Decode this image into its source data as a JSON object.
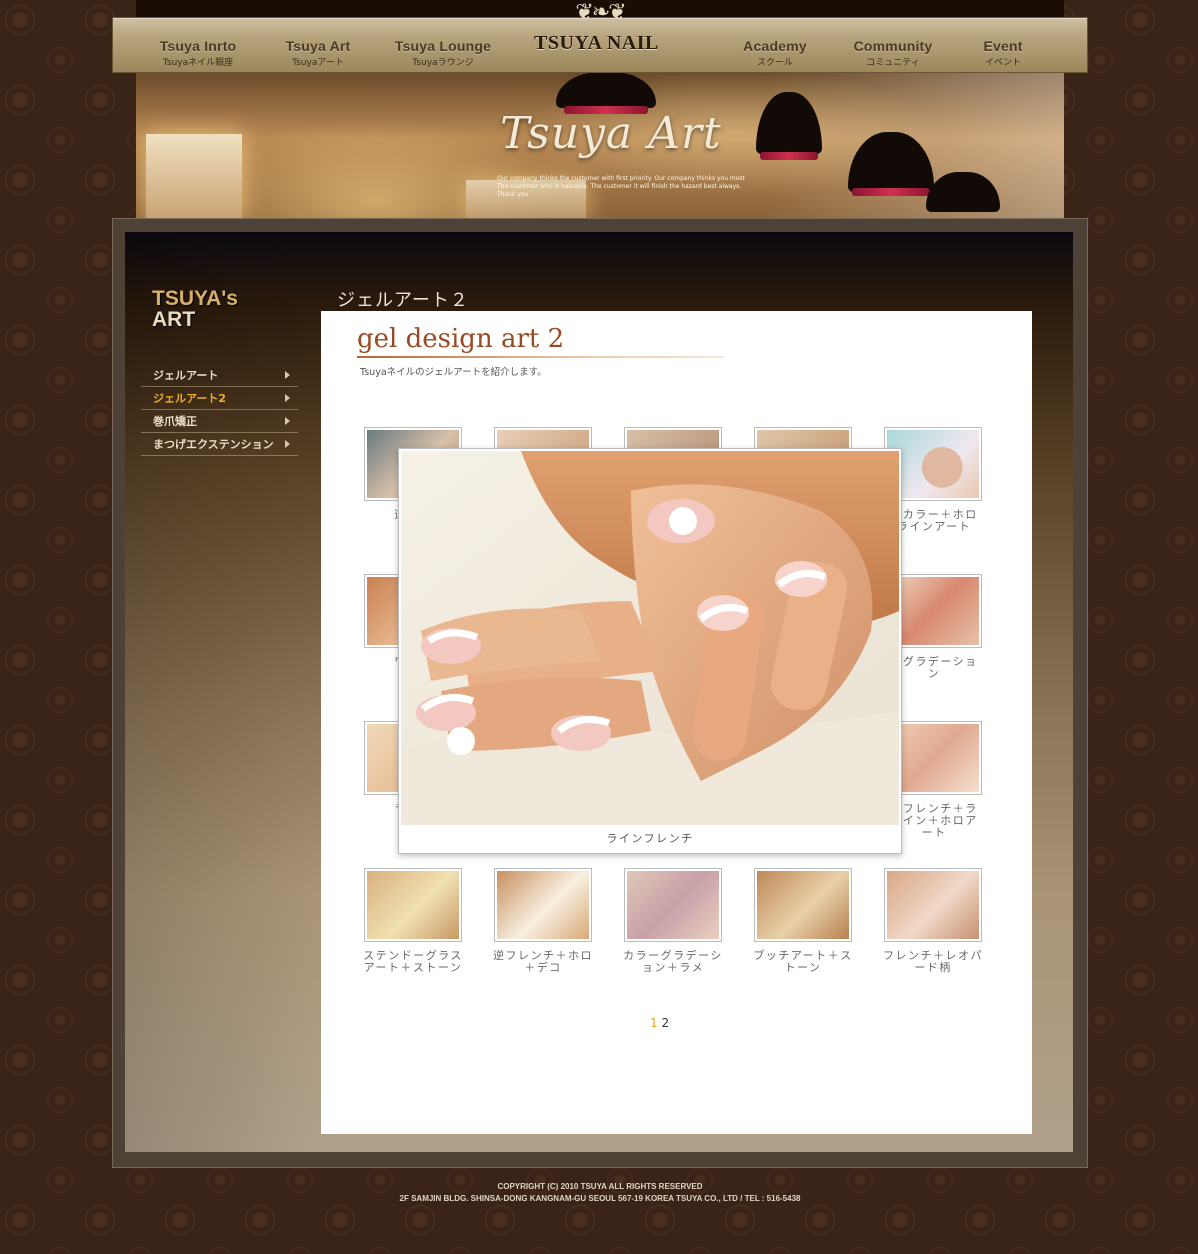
{
  "nav": {
    "items": [
      {
        "main": "Tsuya Inrto",
        "sub": "Tsuyaネイル銀座"
      },
      {
        "main": "Tsuya Art",
        "sub": "Tsuyaアート"
      },
      {
        "main": "Tsuya Lounge",
        "sub": "Tsuyaラウンジ"
      },
      {
        "main": "Academy",
        "sub": "スクール"
      },
      {
        "main": "Community",
        "sub": "コミュニティ"
      },
      {
        "main": "Event",
        "sub": "イベント"
      }
    ],
    "logo": "TSUYA NAIL"
  },
  "hero": {
    "title": "Tsuya Art",
    "tagline": "Our company thinks the customer with first priority. Our company thinks you most The customer who is valuable. The customer it will finish the hazard best always. Thank you."
  },
  "sidebar": {
    "title_line1": "TSUYA's",
    "title_line2": "ART",
    "items": [
      {
        "label": "ジェルアート"
      },
      {
        "label": "ジェルアート2"
      },
      {
        "label": "巻爪矯正"
      },
      {
        "label": "まつげエクステンション"
      }
    ]
  },
  "content": {
    "page_title": "ジェルアート２",
    "heading": "gel design art 2",
    "subheading": "Tsuyaネイルのジェルアートを紹介します。"
  },
  "gallery": {
    "visible_captions": {
      "r1c1": "逆フレ",
      "r1c5": "ンカラー＋ホロ\nラインアート",
      "r2c1": "ワンカ",
      "r2c5": "メグラデーショ\nン",
      "r3c1": "ラメフ",
      "r3c5": "めフレンチ＋ラ\nライン＋ホロア\nート",
      "r4c1": "ステンドーグラス\nアート＋ストーン",
      "r4c2": "逆フレンチ＋ホロ\n＋デコ",
      "r4c3": "カラーグラデーシ\nョン＋ラメ",
      "r4c4": "ブッチアート＋ス\nトーン",
      "r4c5": "フレンチ＋レオパ\nード柄"
    }
  },
  "pager": {
    "current": "1",
    "other": "2"
  },
  "popup": {
    "caption": "ラインフレンチ"
  },
  "footer": {
    "line1": "COPYRIGHT (C) 2010 TSUYA  ALL RIGHTS RESERVED",
    "line2": "2F SAMJIN BLDG. SHINSA-DONG KANGNAM-GU SEOUL 567-19 KOREA TSUYA CO., LTD / TEL : 516-5438"
  },
  "colors": {
    "accent": "#f0a020",
    "heading": "#9a4a22",
    "background": "#3a2418"
  }
}
